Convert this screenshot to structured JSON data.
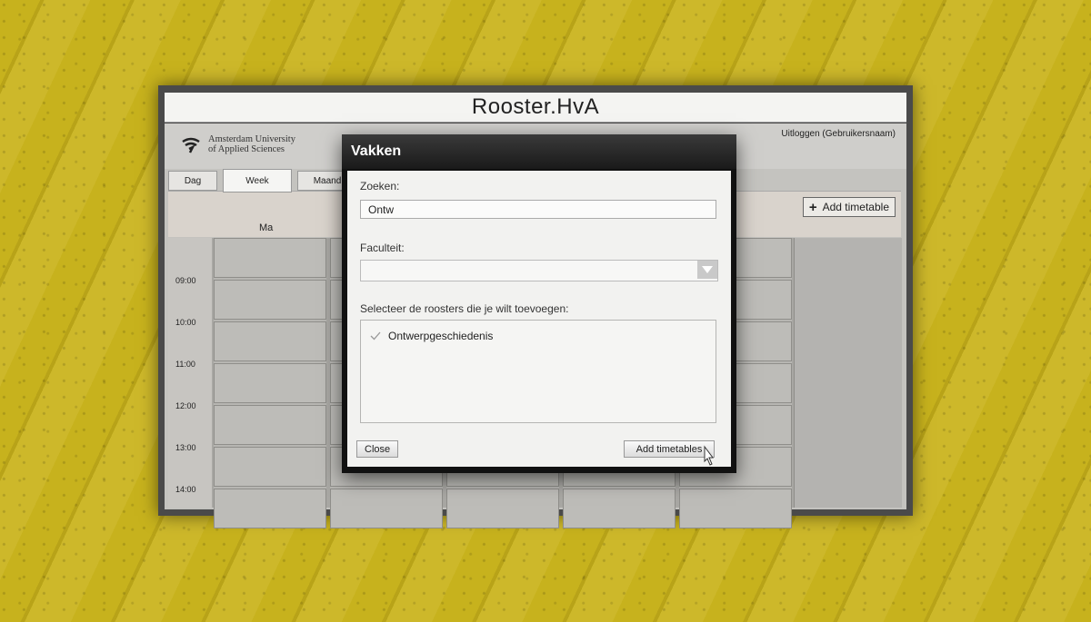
{
  "window": {
    "title": "Rooster.HvA"
  },
  "header": {
    "logo_line1": "Amsterdam University",
    "logo_line2": "of Applied Sciences",
    "logout": "Uitloggen (Gebruikersnaam)"
  },
  "views": {
    "day": "Dag",
    "week": "Week",
    "month": "Maand"
  },
  "toolbar": {
    "add_timetable": "Add timetable",
    "plus": "+"
  },
  "calendar": {
    "days": [
      "Ma"
    ],
    "times": [
      "09:00",
      "10:00",
      "11:00",
      "12:00",
      "13:00",
      "14:00"
    ]
  },
  "dialog": {
    "title": "Vakken",
    "search_label": "Zoeken:",
    "search_value": "Ontw",
    "faculty_label": "Faculteit:",
    "faculty_value": "",
    "select_label": "Selecteer de roosters die je wilt toevoegen:",
    "items": [
      {
        "label": "Ontwerpgeschiedenis",
        "checked": true
      }
    ],
    "close_label": "Close",
    "add_label": "Add timetables"
  },
  "colors": {
    "background": "#c7b21d",
    "dialog_title": "#1a1a1a"
  }
}
